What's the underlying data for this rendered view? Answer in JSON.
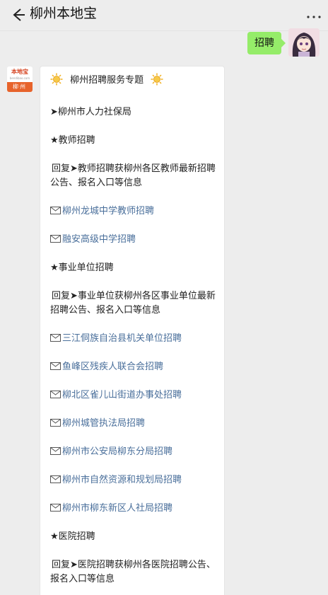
{
  "header": {
    "title": "柳州本地宝",
    "back_icon": "arrow-left-icon",
    "more_icon": "ellipsis-icon"
  },
  "me": {
    "message": "招聘"
  },
  "bot": {
    "avatar": {
      "brand": "本地宝",
      "site": "bendibao.com",
      "city": "柳州"
    },
    "topic": "柳州招聘服务专题",
    "labor_bureau": "柳州市人力社保局",
    "section_teacher": "教师招聘",
    "reply_teacher": "回复➤教师招聘获柳州各区教师最新招聘公告、报名入口等信息",
    "teacher_links": [
      "柳州龙城中学教师招聘",
      "融安高级中学招聘"
    ],
    "section_public": "事业单位招聘",
    "reply_public": "回复➤事业单位获柳州各区事业单位最新招聘公告、报名入口等信息",
    "public_links": [
      "三江侗族自治县机关单位招聘",
      "鱼峰区残疾人联合会招聘",
      "柳北区雀儿山街道办事处招聘",
      "柳州城管执法局招聘",
      "柳州市公安局柳东分局招聘",
      "柳州市自然资源和规划局招聘",
      "柳州市柳东新区人社局招聘"
    ],
    "section_hospital": "医院招聘",
    "reply_hospital": "回复➤医院招聘获柳州各医院招聘公告、报名入口等信息"
  },
  "colors": {
    "bubble_green": "#95ec69",
    "link_blue": "#4a6f9b",
    "brand_orange": "#e7632b"
  }
}
